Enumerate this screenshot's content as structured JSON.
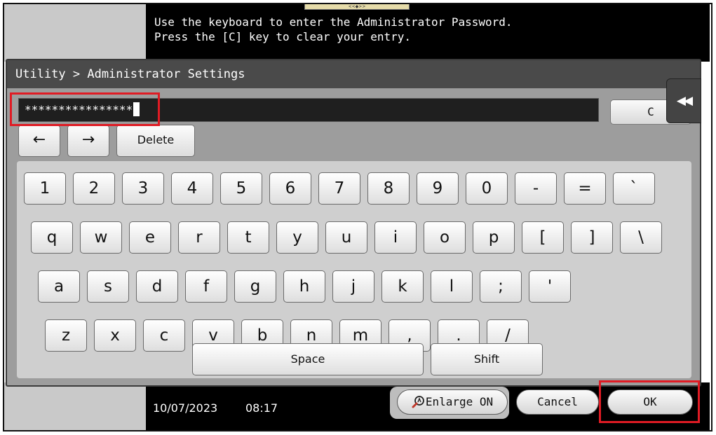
{
  "message": {
    "line1": "Use the keyboard to enter the Administrator Password.",
    "line2": "Press the [C] key to clear your entry."
  },
  "top_tab_glyph": "<<◆>>",
  "breadcrumb": "Utility > Administrator Settings",
  "password_field": {
    "value": "****************"
  },
  "clear_label": "C",
  "collapse_glyph": "◀◀",
  "nav": {
    "left": "←",
    "right": "→",
    "delete": "Delete"
  },
  "keyboard": {
    "row1": [
      "1",
      "2",
      "3",
      "4",
      "5",
      "6",
      "7",
      "8",
      "9",
      "0",
      "-",
      "=",
      "`"
    ],
    "row2": [
      "q",
      "w",
      "e",
      "r",
      "t",
      "y",
      "u",
      "i",
      "o",
      "p",
      "[",
      "]",
      "\\"
    ],
    "row3": [
      "a",
      "s",
      "d",
      "f",
      "g",
      "h",
      "j",
      "k",
      "l",
      ";",
      "'"
    ],
    "row4": [
      "z",
      "x",
      "c",
      "v",
      "b",
      "n",
      "m",
      ",",
      ".",
      "/"
    ],
    "space": "Space",
    "shift": "Shift"
  },
  "status": {
    "date": "10/07/2023",
    "time": "08:17"
  },
  "buttons": {
    "enlarge": "Enlarge ON",
    "cancel": "Cancel",
    "ok": "OK"
  },
  "colors": {
    "highlight": "#e01b24",
    "screen_bg": "#000000",
    "dialog_bg": "#9d9d9d"
  }
}
